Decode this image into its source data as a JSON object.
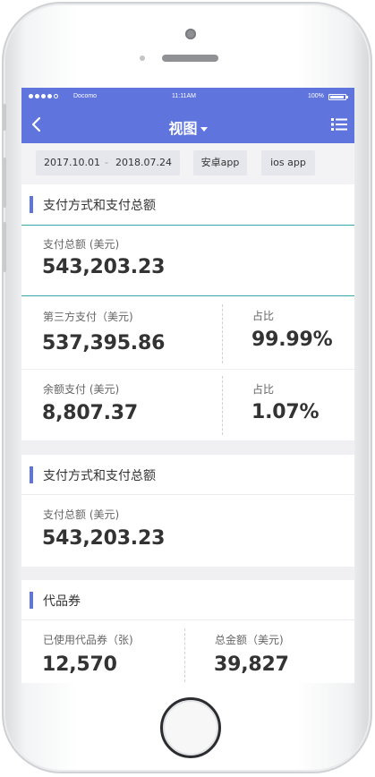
{
  "status_bar": {
    "carrier": "Docomo",
    "time": "11:11AM",
    "battery": "100%"
  },
  "nav": {
    "title": "视图"
  },
  "filters": {
    "start_date": "2017.10.01",
    "separator": "-",
    "end_date": "2018.07.24",
    "android": "安卓app",
    "ios": "ios app"
  },
  "section1": {
    "title": "支付方式和支付总额",
    "total_label": "支付总额 (美元)",
    "total_value": "543,203.23",
    "third_party_label": "第三方支付（美元)",
    "third_party_value": "537,395.86",
    "third_party_share_label": "占比",
    "third_party_share_value": "99.99%",
    "balance_label": "余额支付 (美元)",
    "balance_value": "8,807.37",
    "balance_share_label": "占比",
    "balance_share_value": "1.07%"
  },
  "section2": {
    "title": "支付方式和支付总额",
    "total_label": "支付总额 (美元)",
    "total_value": "543,203.23"
  },
  "section3": {
    "title": "代品券",
    "used_label": "已使用代品券（张)",
    "used_value": "12,570",
    "amount_label": "总金额（美元)",
    "amount_value": "39,827"
  },
  "colors": {
    "primary": "#5f74dd",
    "teal_divider": "#3aa6a8"
  }
}
